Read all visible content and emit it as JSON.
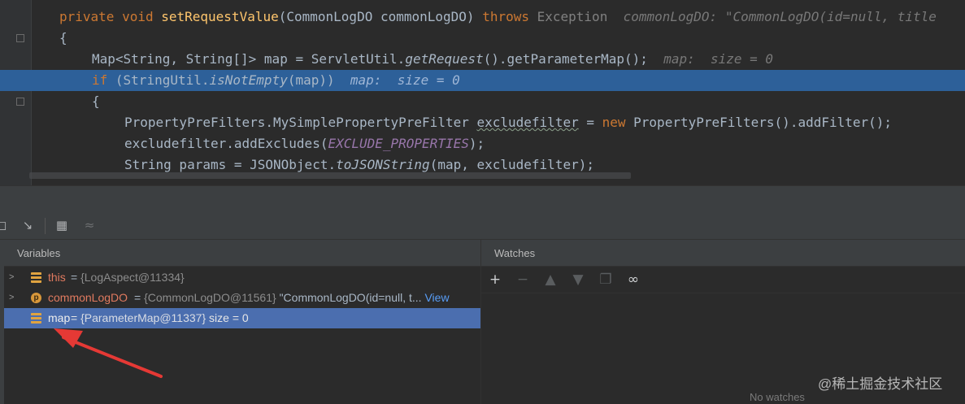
{
  "editor": {
    "lines": [
      {
        "kw1": "private void ",
        "fn": "setRequestValue",
        "p1": "(CommonLogDO commonLogDO) ",
        "kw2": "throws ",
        "exc": "Exception",
        "hint": "  commonLogDO: \"CommonLogDO(id=null, title"
      },
      {
        "text": "{"
      },
      {
        "a": "Map<String, String[]> map = ServletUtil.",
        "b": "getRequest",
        "c": "().getParameterMap();",
        "hint": "  map:  size = 0"
      },
      {
        "kw": "if ",
        "a": "(StringUtil.",
        "b": "isNotEmpty",
        "c": "(map))",
        "hint": "  map:  size = 0"
      },
      {
        "text": "{"
      },
      {
        "a": "PropertyPreFilters.MySimplePropertyPreFilter ",
        "sq": "excludefilter",
        "b": " = ",
        "kw": "new ",
        "c": "PropertyPreFilters().addFilter();"
      },
      {
        "a": "excludefilter.addExcludes(",
        "const": "EXCLUDE_PROPERTIES",
        "c": ");"
      },
      {
        "a": "String params = JSONObject.",
        "b": "toJSONString",
        "c": "(map, excludefilter);"
      }
    ]
  },
  "debugger": {
    "variables_title": "Variables",
    "watches_title": "Watches",
    "no_watches": "No watches",
    "rows": [
      {
        "name": "this",
        "eq": " = ",
        "value": "{LogAspect@11334}",
        "extra": "",
        "link": ""
      },
      {
        "name": "commonLogDO",
        "eq": " = ",
        "value": "{CommonLogDO@11561}",
        "extra": " \"CommonLogDO(id=null, t...",
        "link": " View"
      },
      {
        "name": "map",
        "eq": " = ",
        "value": "{ParameterMap@11337}",
        "extra": "  size = 0",
        "link": ""
      }
    ],
    "param_badge": "p"
  },
  "watermark": "@稀土掘金技术社区",
  "colors": {
    "selection": "#4b6eaf",
    "highlight": "#2d6099",
    "arrow": "#e53935"
  }
}
